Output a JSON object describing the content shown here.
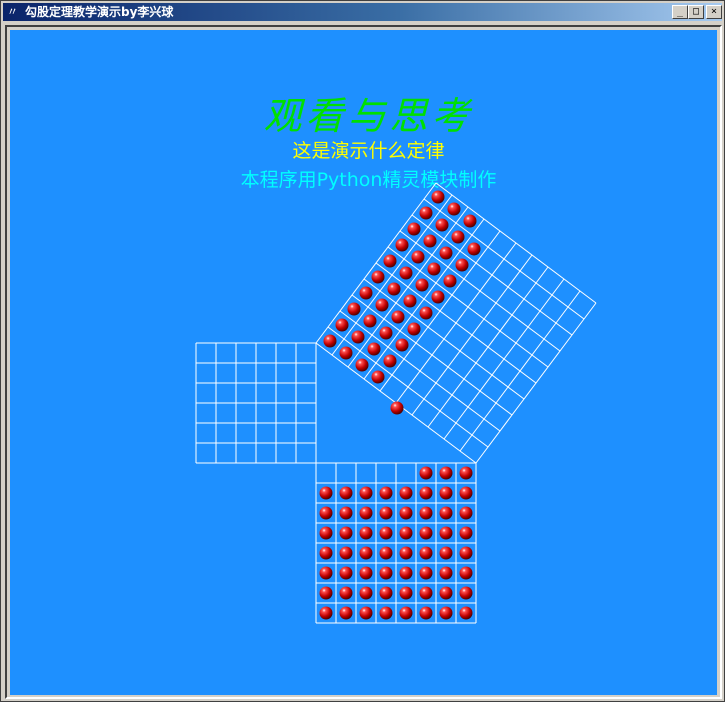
{
  "window": {
    "title": "勾股定理教学演示by李兴球",
    "controls": {
      "minimize": "_",
      "maximize": "□",
      "close": "×"
    }
  },
  "canvas": {
    "background": "#1e90ff",
    "title": "观看与思考",
    "subtitle": "这是演示什么定律",
    "credit": "本程序用Python精灵模块制作",
    "title_color": "#00e000",
    "subtitle_color": "#ffff00",
    "credit_color": "#00ffff"
  },
  "demo": {
    "grid_color": "#ffffff",
    "ball_color": "#cc1010",
    "triangle_legs": [
      6,
      8
    ],
    "hypotenuse": 10,
    "square_a_balls": 0,
    "square_b_balls": 61,
    "square_c_balls": 39,
    "moving_balls": 1
  },
  "icons": {
    "app": "feather-icon"
  }
}
